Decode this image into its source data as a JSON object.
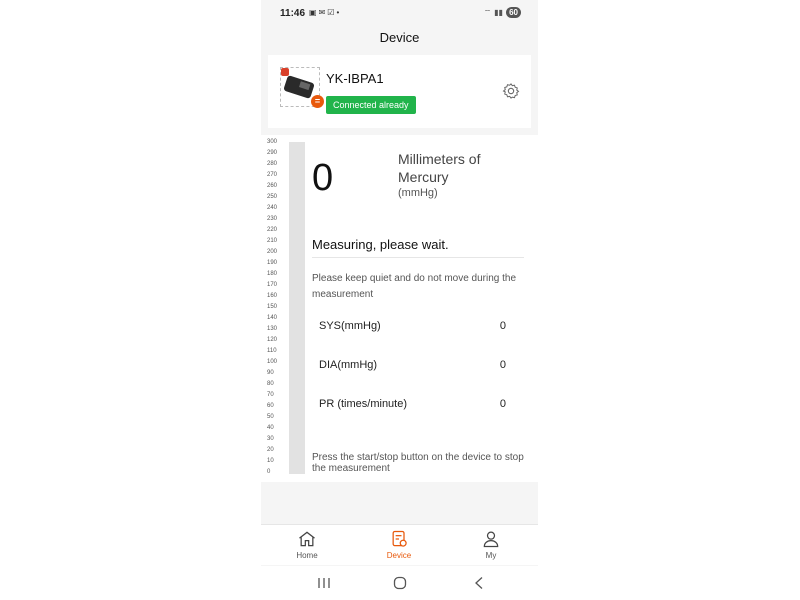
{
  "status_bar": {
    "time": "11:46",
    "left_icons": [
      "gallery-icon",
      "chat-icon",
      "check-icon",
      "dot-icon"
    ],
    "battery": "60"
  },
  "header": {
    "title": "Device"
  },
  "device": {
    "name": "YK-IBPA1",
    "status": "Connected already",
    "status_color": "#21b44b"
  },
  "gauge": {
    "ticks": [
      "300",
      "290",
      "280",
      "270",
      "260",
      "250",
      "240",
      "230",
      "220",
      "210",
      "200",
      "190",
      "180",
      "170",
      "160",
      "150",
      "140",
      "130",
      "120",
      "110",
      "100",
      "90",
      "80",
      "70",
      "60",
      "50",
      "40",
      "30",
      "20",
      "10",
      "0"
    ],
    "max": 300,
    "value": 0
  },
  "measurement": {
    "current_value": "0",
    "unit_name": "Millimeters of Mercury",
    "unit_abbr": "(mmHg)",
    "status": "Measuring, please wait.",
    "instruction": "Please keep quiet and do not move during the measurement",
    "readings": [
      {
        "label": "SYS(mmHg)",
        "value": "0"
      },
      {
        "label": "DIA(mmHg)",
        "value": "0"
      },
      {
        "label": "PR (times/minute)",
        "value": "0"
      }
    ],
    "footer": "Press the start/stop button on the device to stop the measurement"
  },
  "nav": {
    "items": [
      {
        "label": "Home",
        "icon": "home-icon"
      },
      {
        "label": "Device",
        "icon": "device-report-icon"
      },
      {
        "label": "My",
        "icon": "user-icon"
      }
    ],
    "active": "Device",
    "active_color": "#e8590c"
  }
}
